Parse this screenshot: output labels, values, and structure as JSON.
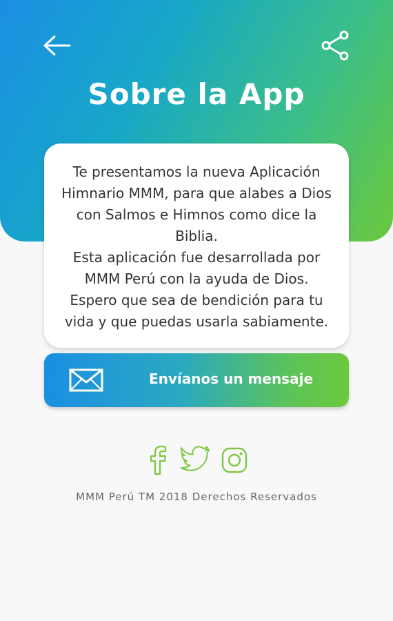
{
  "header": {
    "title": "Sobre la App",
    "back_icon": "arrow-left-icon",
    "share_icon": "share-icon"
  },
  "about": {
    "text": "Te presentamos la nueva Aplicación Himnario MMM, para que alabes a Dios con Salmos e Himnos como dice la Biblia.\nEsta aplicación fue desarrollada por MMM Perú con la ayuda de Dios.\nEspero que sea de bendición para tu vida y que puedas usarla sabiamente."
  },
  "contact": {
    "label": "Envíanos un mensaje",
    "icon": "mail-icon"
  },
  "social": {
    "icons": [
      "facebook-icon",
      "twitter-icon",
      "instagram-icon"
    ],
    "color": "#7dc740"
  },
  "footer": {
    "text": "MMM Perú TM 2018 Derechos Reservados"
  },
  "colors": {
    "gradient_start": "#1a8fe3",
    "gradient_end": "#6cc83c"
  }
}
